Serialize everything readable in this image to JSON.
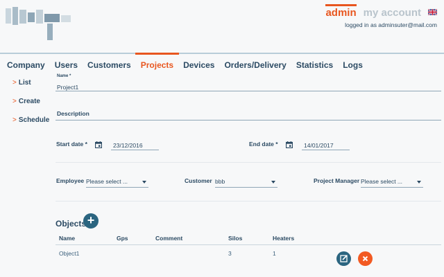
{
  "header": {
    "tabs": [
      {
        "label": "admin",
        "active": true
      },
      {
        "label": "my account",
        "active": false
      }
    ],
    "logged_in_text": "logged in as adminsuter@mail.com",
    "flag_icon": "uk-flag-icon",
    "accent_color": "#e8561f"
  },
  "nav": {
    "items": [
      {
        "label": "Company"
      },
      {
        "label": "Users"
      },
      {
        "label": "Customers"
      },
      {
        "label": "Projects",
        "active": true
      },
      {
        "label": "Devices"
      },
      {
        "label": "Orders/Delivery"
      },
      {
        "label": "Statistics"
      },
      {
        "label": "Logs"
      }
    ]
  },
  "sidebar": {
    "items": [
      {
        "label": "List"
      },
      {
        "label": "Create"
      },
      {
        "label": "Schedule"
      }
    ]
  },
  "form": {
    "name_label": "Name *",
    "name_value": "Project1",
    "description_label": "Description",
    "start_label": "Start date *",
    "start_value": "23/12/2016",
    "end_label": "End date *",
    "end_value": "14/01/2017",
    "employee_label": "Employee",
    "employee_value": "Please select ...",
    "customer_label": "Customer",
    "customer_value": "bbb",
    "pm_label": "Project Manager",
    "pm_value": "Please select ..."
  },
  "objects": {
    "title": "Objects",
    "add_icon": "plus-icon",
    "columns": [
      "Name",
      "Gps",
      "Comment",
      "Silos",
      "Heaters"
    ],
    "rows": [
      {
        "name": "Object1",
        "gps": "",
        "comment": "",
        "silos": "3",
        "heaters": "1"
      }
    ]
  }
}
